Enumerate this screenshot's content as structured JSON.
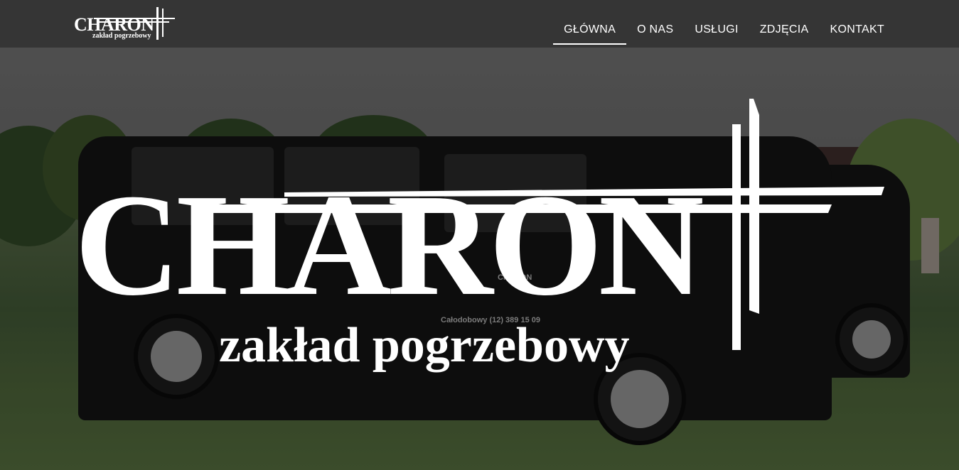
{
  "header": {
    "logo": {
      "word": "CHARON",
      "subtitle": "zakład pogrzebowy"
    },
    "nav": [
      {
        "label": "GŁÓWNA",
        "active": true
      },
      {
        "label": "O NAS",
        "active": false
      },
      {
        "label": "USŁUGI",
        "active": false
      },
      {
        "label": "ZDJĘCIA",
        "active": false
      },
      {
        "label": "KONTAKT",
        "active": false
      }
    ]
  },
  "hero": {
    "logo": {
      "word": "CHARON",
      "subtitle": "zakład pogrzebowy"
    },
    "van_text": {
      "brand": "CHARON",
      "phone": "Całodobowy (12) 389 15 09"
    }
  },
  "colors": {
    "nav_bg": "#353535",
    "text": "#ffffff",
    "overlay": "#000000"
  }
}
